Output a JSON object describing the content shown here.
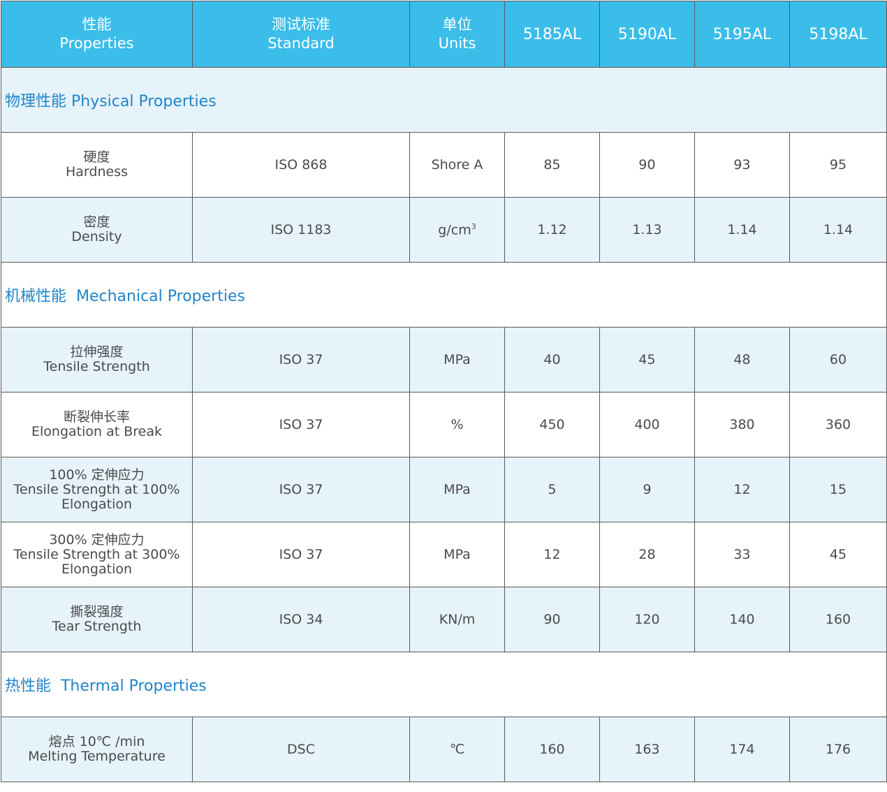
{
  "header": {
    "properties_cn": "性能",
    "properties_en": "Properties",
    "standard_cn": "测试标准",
    "standard_en": "Standard",
    "units_cn": "单位",
    "units_en": "Units",
    "grades": [
      "5185AL",
      "5190AL",
      "5195AL",
      "5198AL"
    ]
  },
  "sections": {
    "physical": "物理性能 Physical Properties",
    "mechanical": "机械性能  Mechanical Properties",
    "thermal": "热性能  Thermal Properties"
  },
  "rows": {
    "hardness": {
      "cn": "硬度",
      "en": "Hardness",
      "standard": "ISO 868",
      "unit": "Shore A",
      "values": [
        "85",
        "90",
        "93",
        "95"
      ]
    },
    "density": {
      "cn": "密度",
      "en": "Density",
      "standard": "ISO 1183",
      "unit_base": "g/cm",
      "unit_sup": "3",
      "values": [
        "1.12",
        "1.13",
        "1.14",
        "1.14"
      ]
    },
    "tensile": {
      "cn": "拉伸强度",
      "en": "Tensile Strength",
      "standard": "ISO 37",
      "unit": "MPa",
      "values": [
        "40",
        "45",
        "48",
        "60"
      ]
    },
    "elongation": {
      "cn": "断裂伸长率",
      "en": "Elongation at Break",
      "standard": "ISO 37",
      "unit": "%",
      "values": [
        "450",
        "400",
        "380",
        "360"
      ]
    },
    "modulus100": {
      "cn": "100% 定伸应力",
      "en1": "Tensile Strength at 100%",
      "en2": "Elongation",
      "standard": "ISO 37",
      "unit": "MPa",
      "values": [
        "5",
        "9",
        "12",
        "15"
      ]
    },
    "modulus300": {
      "cn": "300% 定伸应力",
      "en1": "Tensile Strength at 300%",
      "en2": "Elongation",
      "standard": "ISO 37",
      "unit": "MPa",
      "values": [
        "12",
        "28",
        "33",
        "45"
      ]
    },
    "tear": {
      "cn": "撕裂强度",
      "en": "Tear Strength",
      "standard": "ISO 34",
      "unit": "KN/m",
      "values": [
        "90",
        "120",
        "140",
        "160"
      ]
    },
    "melting": {
      "cn": "熔点 10℃ /min",
      "en": "Melting Temperature",
      "standard": "DSC",
      "unit": "℃",
      "values": [
        "160",
        "163",
        "174",
        "176"
      ]
    }
  }
}
